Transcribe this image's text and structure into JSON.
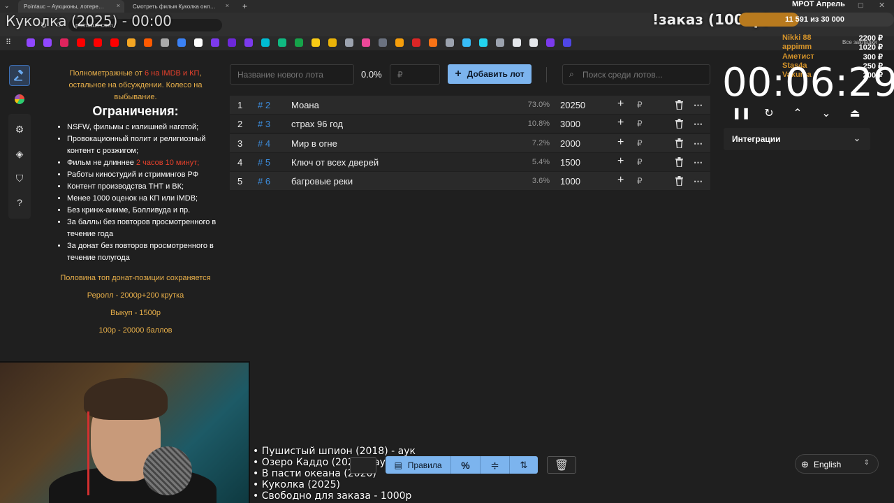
{
  "browser": {
    "tabs": [
      {
        "label": "Pointauc – Аукционы, лотере…",
        "active": true
      },
      {
        "label": "Смотреть фильм Куколка онл…",
        "active": false
      }
    ],
    "url": "pointauc.com",
    "all_bookmarks": "Все закладки"
  },
  "overlay": {
    "stream_title": "Куколка (2025) - 00:00",
    "order_title": "!заказ (1000р)",
    "goal_title": "МРОТ Апрель",
    "goal_text": "11 591  из 30 000",
    "goal_fraction": 0.386,
    "donors": [
      {
        "name": "Nikki 88",
        "amount": "2200 ₽"
      },
      {
        "name": "appimm",
        "amount": "1020 ₽"
      },
      {
        "name": "Аметист",
        "amount": "300 ₽"
      },
      {
        "name": "Stas4a",
        "amount": "250 ₽"
      },
      {
        "name": "Vakuma",
        "amount": "200 ₽"
      }
    ],
    "bottom_list": [
      "• Пушистый шпион (2018) - аук",
      "• Озеро Каддо (2023) - аук",
      "• В пасти океана (2020)",
      "• Куколка (2025)",
      "• Свободно для заказа - 1000р"
    ]
  },
  "rules": {
    "intro_a": "Полнометражные от ",
    "intro_b": "6 на IMDB и КП",
    "intro_c": ", остальное на обсуждении. Колесо на выбывание.",
    "limits_title": "Ограничения:",
    "items": [
      "NSFW, фильмы с излишней наготой;",
      "Провокационный полит и религиозный контент с розжигом;",
      "Фильм не длиннее ",
      "Работы киностудий и стримингов РФ",
      "Контент производства ТНТ и ВК;",
      "Менее 1000 оценок на КП или iMDB;",
      "Без кринж-аниме, Болливуда и пр.",
      "За баллы без повторов просмотренного в течение года",
      "За донат без повторов просмотренного в течение полугода"
    ],
    "length_limit": "2 часов 10 минут;",
    "footer": [
      "Половина топ донат-позиции сохраняется",
      "Реролл - 2000р+200 крутка",
      "Выкуп - 1500р",
      "100р - 20000 баллов"
    ]
  },
  "lot_form": {
    "name_placeholder": "Название нового лота",
    "total_percent": "0.0%",
    "amount_placeholder": "₽",
    "add_label": "Добавить лот",
    "search_placeholder": "Поиск среди лотов..."
  },
  "lots": [
    {
      "index": "1",
      "id": "# 2",
      "name": "Моана",
      "percent": "73.0%",
      "amount": "20250"
    },
    {
      "index": "2",
      "id": "# 3",
      "name": "страх 96 год",
      "percent": "10.8%",
      "amount": "3000"
    },
    {
      "index": "3",
      "id": "# 4",
      "name": "Мир в огне",
      "percent": "7.2%",
      "amount": "2000"
    },
    {
      "index": "4",
      "id": "# 5",
      "name": "Ключ от всех дверей",
      "percent": "5.4%",
      "amount": "1500"
    },
    {
      "index": "5",
      "id": "# 6",
      "name": "багровые реки",
      "percent": "3.6%",
      "amount": "1000"
    }
  ],
  "currency_symbol": "₽",
  "timer": {
    "value": "00:06:29",
    "integrations_label": "Интеграции"
  },
  "toolbar": {
    "rules_label": "Правила",
    "percent_symbol": "%"
  },
  "language": "English"
}
